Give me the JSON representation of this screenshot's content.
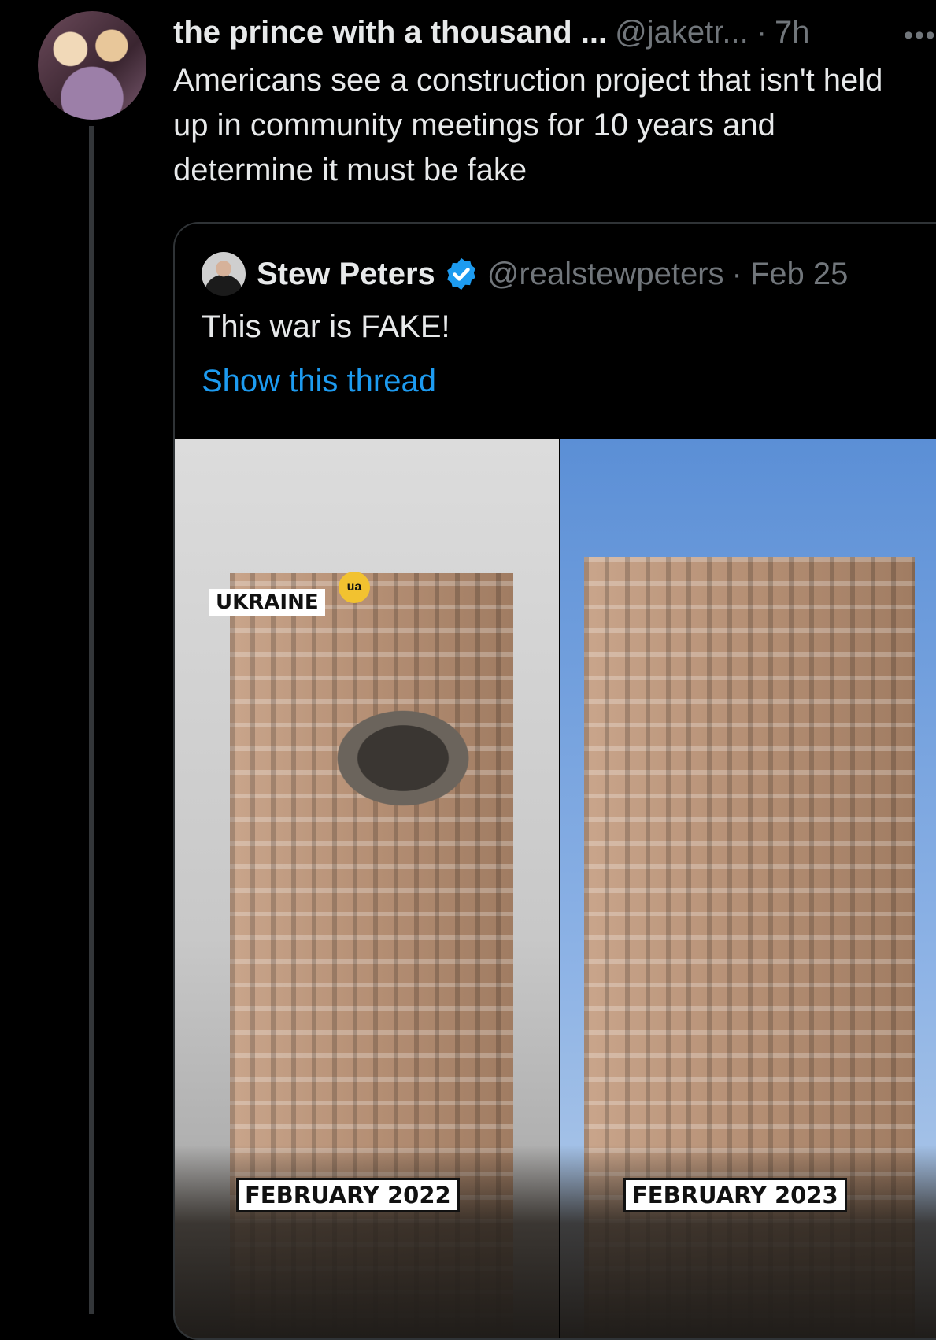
{
  "tweet": {
    "display_name": "the prince with a thousand ...",
    "handle": "@jaketr...",
    "separator": "·",
    "time": "7h",
    "more": "•••",
    "text": "Americans see a construction project that isn't held up in community meetings for 10 years and determine it must be fake"
  },
  "quote": {
    "display_name": "Stew Peters",
    "handle": "@realstewpeters",
    "separator": "·",
    "date": "Feb 25",
    "text": "This war is FAKE!",
    "show_thread": "Show this thread",
    "image": {
      "left_label_top": "UKRAINE",
      "badge": "ua",
      "left_caption": "FEBRUARY 2022",
      "right_caption": "FEBRUARY 2023"
    }
  },
  "colors": {
    "background": "#000000",
    "text": "#e7e9ea",
    "muted": "#71767b",
    "link": "#1d9bf0",
    "verified": "#1d9bf0",
    "border": "#2f3336"
  },
  "icons": [
    "verified-badge-icon",
    "more-options-icon"
  ]
}
